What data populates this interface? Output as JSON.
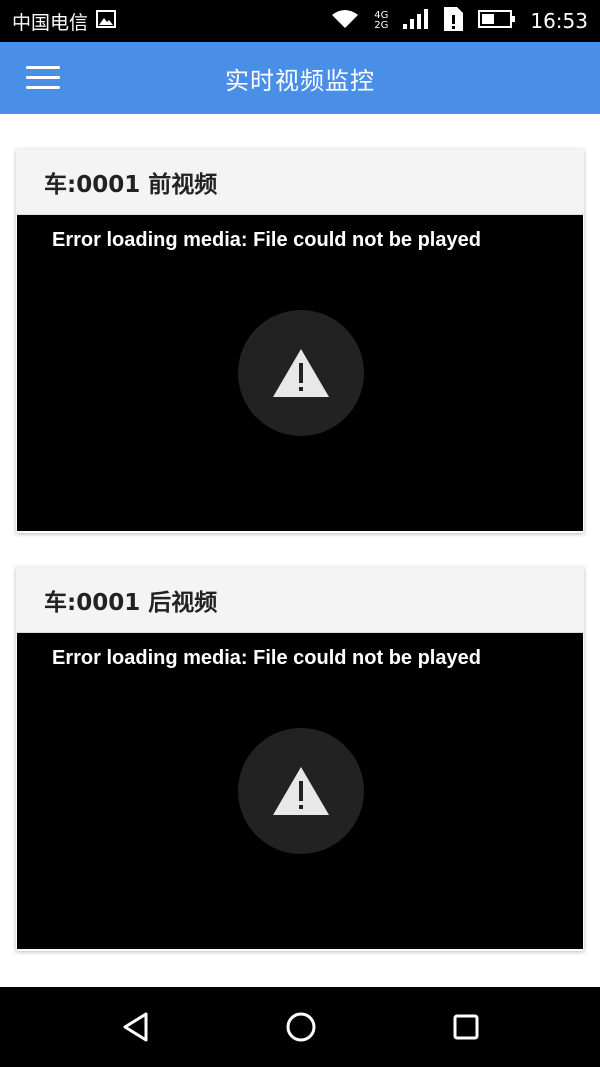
{
  "status_bar": {
    "carrier": "中国电信",
    "network": "4G\n2G",
    "time": "16:53"
  },
  "app_bar": {
    "title": "实时视频监控",
    "menu_icon": "hamburger-menu-icon"
  },
  "cards": [
    {
      "title": "车:0001 前视频",
      "error": "Error loading media: File could not be played",
      "icon": "warning-icon"
    },
    {
      "title": "车:0001 后视频",
      "error": "Error loading media: File could not be played",
      "icon": "warning-icon"
    }
  ],
  "nav_bar": {
    "back_icon": "back-triangle-icon",
    "home_icon": "home-circle-icon",
    "recents_icon": "recents-square-icon"
  },
  "colors": {
    "app_bar": "#4a8fe7",
    "card_header": "#f4f4f4",
    "video_bg": "#000000"
  }
}
